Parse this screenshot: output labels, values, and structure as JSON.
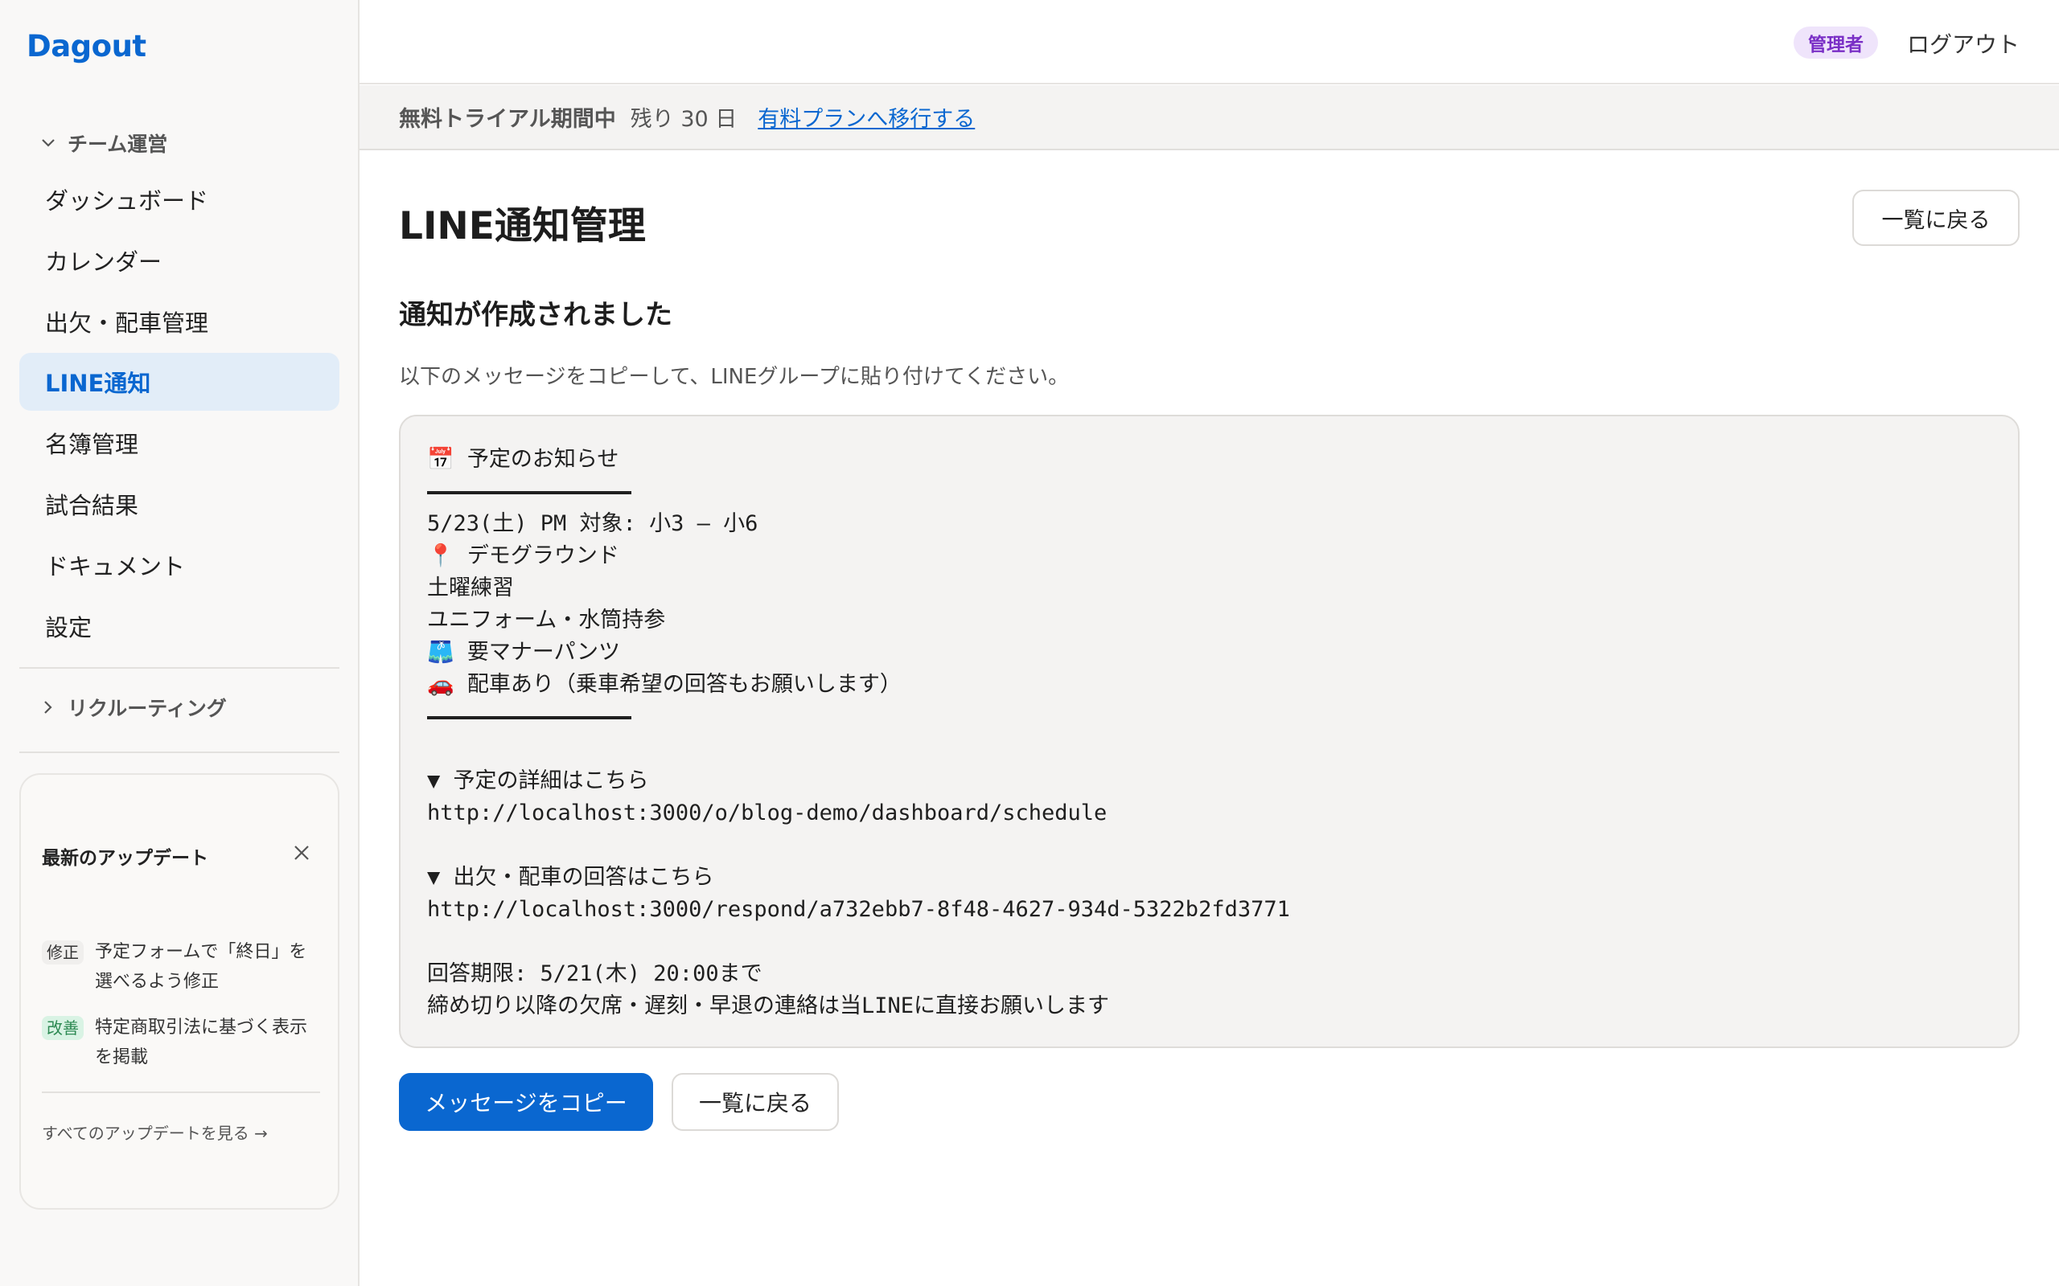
{
  "app": {
    "brand": "Dagout"
  },
  "sidebar": {
    "section_team": {
      "label": "チーム運営",
      "icon": "chevron-down-icon"
    },
    "items": [
      {
        "label": "ダッシュボード",
        "active": false
      },
      {
        "label": "カレンダー",
        "active": false
      },
      {
        "label": "出欠・配車管理",
        "active": false
      },
      {
        "label": "LINE通知",
        "active": true
      },
      {
        "label": "名簿管理",
        "active": false
      },
      {
        "label": "試合結果",
        "active": false
      },
      {
        "label": "ドキュメント",
        "active": false
      },
      {
        "label": "設定",
        "active": false
      }
    ],
    "section_recruiting": {
      "label": "リクルーティング",
      "icon": "chevron-right-icon"
    },
    "updates": {
      "title": "最新のアップデート",
      "close_icon": "close-icon",
      "entries": [
        {
          "tag": "修正",
          "text_line1": "予定フォームで「終日」を",
          "text_line2": "選べるよう修正"
        },
        {
          "tag": "改善",
          "text_line1": "特定商取引法に基づく表示",
          "text_line2": "を掲載"
        }
      ],
      "view_all": "すべてのアップデートを見る →"
    }
  },
  "header": {
    "role_badge": "管理者",
    "logout": "ログアウト"
  },
  "trial_banner": {
    "status": "無料トライアル期間中",
    "remaining": "残り 30 日",
    "upgrade_link": "有料プランへ移行する"
  },
  "main": {
    "title": "LINE通知管理",
    "back_button": "一覧に戻る",
    "success_heading": "通知が作成されました",
    "instruction": "以下のメッセージをコピーして、LINEグループに貼り付けてください。",
    "message": {
      "header": "📅 予定のお知らせ",
      "body_lines": [
        "5/23(土) PM 対象: 小3 – 小6",
        "📍 デモグラウンド",
        "土曜練習",
        "ユニフォーム・水筒持参",
        "🩳 要マナーパンツ",
        "🚗 配車あり（乗車希望の回答もお願いします）"
      ],
      "schedule_label": "▼ 予定の詳細はこちら",
      "schedule_url": "http://localhost:3000/o/blog-demo/dashboard/schedule",
      "respond_label": "▼ 出欠・配車の回答はこちら",
      "respond_url": "http://localhost:3000/respond/a732ebb7-8f48-4627-934d-5322b2fd3771",
      "deadline": "回答期限: 5/21(木) 20:00まで",
      "note": "締め切り以降の欠席・遅刻・早退の連絡は当LINEに直接お願いします"
    },
    "copy_button": "メッセージをコピー",
    "back_button_bottom": "一覧に戻る"
  },
  "colors": {
    "accent": "#0a67d0",
    "active_bg": "#e2edf8",
    "badge_bg": "#efe4fb",
    "badge_text": "#7a2fc6",
    "improve_bg": "#d9f3e4",
    "improve_text": "#2e8a53"
  }
}
